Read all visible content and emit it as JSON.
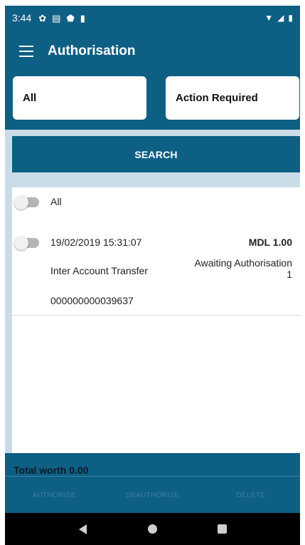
{
  "status_bar": {
    "time": "3:44",
    "left_icons": [
      "gear-icon",
      "message-icon",
      "shield-icon",
      "sdcard-icon"
    ],
    "right_icons": [
      "wifi-icon",
      "signal-icon",
      "battery-icon"
    ]
  },
  "app_bar": {
    "title": "Authorisation"
  },
  "filters": {
    "left": "All",
    "right": "Action Required"
  },
  "search": {
    "label": "SEARCH"
  },
  "list": {
    "all_label": "All",
    "transactions": [
      {
        "date": "19/02/2019 15:31:07",
        "amount": "MDL 1.00",
        "type": "Inter Account Transfer",
        "status_line1": "Awaiting Authorisation",
        "status_line2": "1",
        "reference": "000000000039637"
      }
    ]
  },
  "footer": {
    "total": "Total worth 0.00",
    "actions": [
      "AUTHORISE",
      "DEAUTHORISE",
      "DELETE"
    ]
  },
  "colors": {
    "primary": "#0e5f84",
    "background": "#c9dce8",
    "disabled_action": "#3d7fa1"
  }
}
